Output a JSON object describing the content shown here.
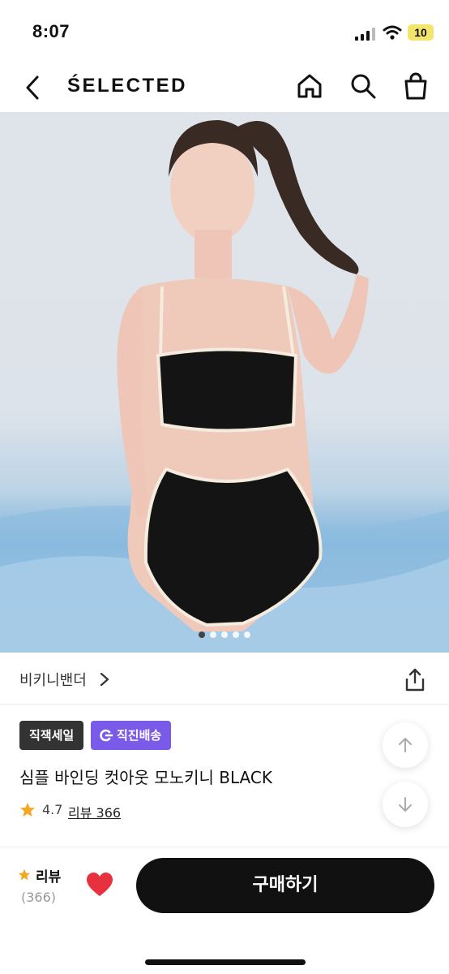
{
  "status_bar": {
    "time": "8:07",
    "battery": "10"
  },
  "nav": {
    "brand": "ŚELECTED",
    "icons": [
      "back-icon",
      "home-icon",
      "search-icon",
      "shopping-bag-icon"
    ]
  },
  "gallery": {
    "image_description_icon": "product-photo",
    "slide_count": 5,
    "active_slide": 1
  },
  "brand_row": {
    "brand_name": "비키니밴더",
    "chevron": ">"
  },
  "product": {
    "badges": {
      "sale": "직잭세일",
      "direct": "직진배송"
    },
    "name": "심플 바인딩 컷아웃 모노키니 BLACK",
    "rating": "4.7",
    "review_link": "리뷰 366"
  },
  "bottom_bar": {
    "review_label": "리뷰",
    "review_count": "(366)",
    "buy_label": "구매하기"
  },
  "colors": {
    "accent_purple": "#7a5ae8",
    "heart_red": "#e8313f",
    "star_orange": "#f5a623",
    "button_black": "#111111"
  }
}
